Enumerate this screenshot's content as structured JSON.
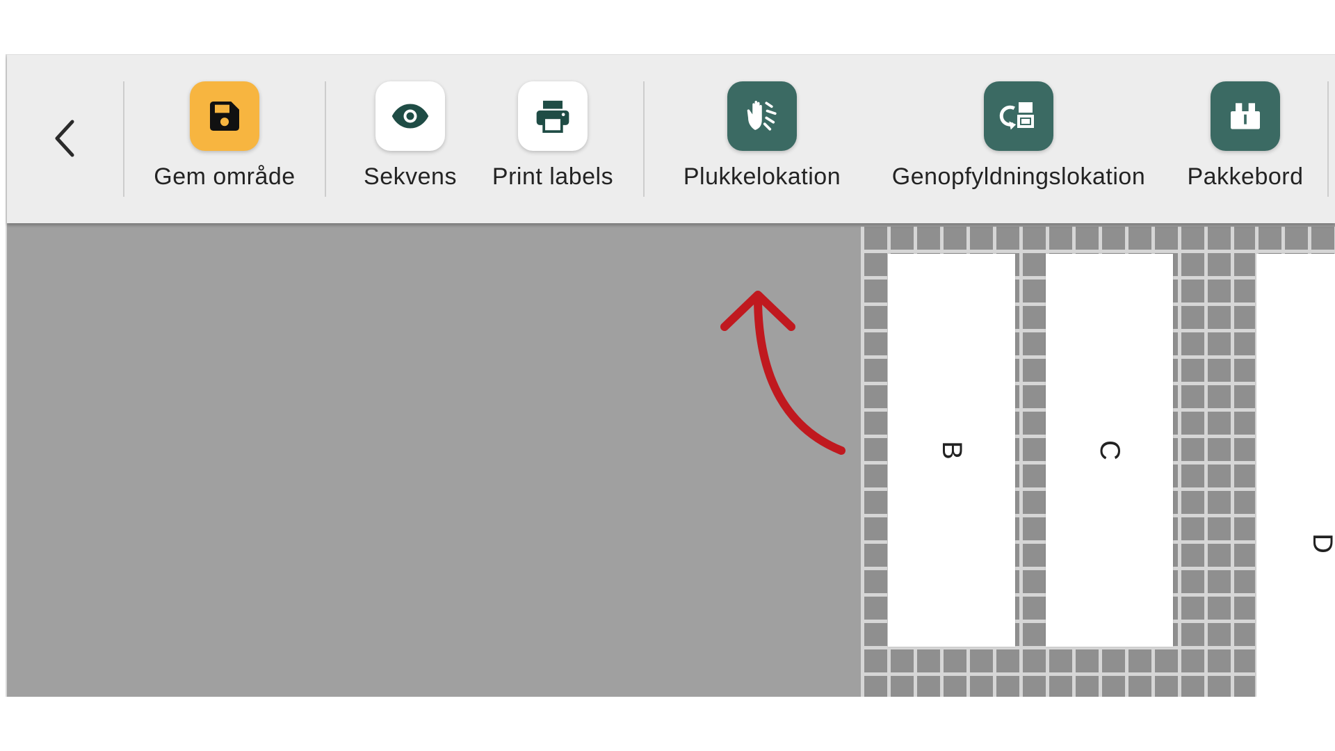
{
  "toolbar": {
    "back_label": "back",
    "buttons": [
      {
        "label": "Gem område",
        "icon": "floppy-disk-icon",
        "color": "#f7b540"
      },
      {
        "label": "Sekvens",
        "icon": "eye-icon",
        "color": "#ffffff"
      },
      {
        "label": "Print labels",
        "icon": "printer-icon",
        "color": "#ffffff"
      },
      {
        "label": "Plukkelokation",
        "icon": "hand-pick-icon",
        "color": "#3b6a63"
      },
      {
        "label": "Genopfyldningslokation",
        "icon": "replenish-icon",
        "color": "#3b6a63"
      },
      {
        "label": "Pakkebord",
        "icon": "packing-table-icon",
        "color": "#3b6a63"
      }
    ]
  },
  "canvas": {
    "background": "#a0a0a0",
    "racks": [
      {
        "letter": "B"
      },
      {
        "letter": "C"
      },
      {
        "letter": "D"
      }
    ]
  },
  "annotation": {
    "arrow_color": "#c0191f",
    "points_to": "Plukkelokation"
  }
}
